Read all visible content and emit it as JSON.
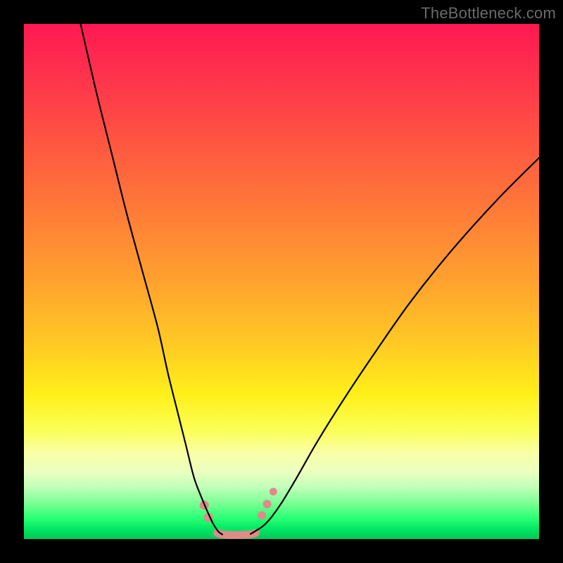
{
  "watermark": "TheBottleneck.com",
  "chart_data": {
    "type": "line",
    "title": "",
    "xlabel": "",
    "ylabel": "",
    "xlim": [
      0,
      100
    ],
    "ylim": [
      0,
      100
    ],
    "grid": false,
    "legend": false,
    "background_gradient": {
      "top": "#ff1852",
      "mid_high": "#ff7a38",
      "mid": "#ffe11e",
      "mid_low": "#faffa3",
      "bottom": "#00c658"
    },
    "series": [
      {
        "name": "left-curve",
        "color": "#000000",
        "x": [
          11,
          14,
          17,
          20,
          23,
          26,
          28,
          30,
          31.5,
          33,
          34.5,
          36,
          37,
          37.8,
          38.5
        ],
        "values": [
          100,
          87,
          75,
          63,
          52,
          41,
          32,
          24,
          18,
          12,
          8,
          4.5,
          2.5,
          1.4,
          0.9
        ]
      },
      {
        "name": "right-curve",
        "color": "#000000",
        "x": [
          44,
          45,
          46.5,
          48,
          50,
          53,
          57,
          62,
          68,
          75,
          83,
          92,
          100
        ],
        "values": [
          1.0,
          1.6,
          2.6,
          4.2,
          7,
          12,
          19,
          27,
          36,
          46,
          56,
          66,
          74
        ]
      },
      {
        "name": "valley-floor",
        "color": "#e08a8a",
        "stroke_width": 11,
        "x": [
          37.5,
          38.5,
          40,
          42,
          44,
          45
        ],
        "values": [
          1.2,
          0.9,
          0.8,
          0.8,
          0.9,
          1.2
        ]
      }
    ],
    "markers": [
      {
        "name": "left-dot-upper",
        "x": 35.0,
        "y": 6.6,
        "r": 6.5,
        "fill": "#e08a8a"
      },
      {
        "name": "left-dot-lower",
        "x": 35.8,
        "y": 4.2,
        "r": 6.5,
        "fill": "#e08a8a"
      },
      {
        "name": "right-dot-lower",
        "x": 46.2,
        "y": 4.6,
        "r": 6.0,
        "fill": "#e08a8a"
      },
      {
        "name": "right-dot-mid",
        "x": 47.2,
        "y": 6.8,
        "r": 6.0,
        "fill": "#e08a8a"
      },
      {
        "name": "right-dot-upper",
        "x": 48.4,
        "y": 9.2,
        "r": 5.5,
        "fill": "#e08a8a"
      }
    ]
  }
}
